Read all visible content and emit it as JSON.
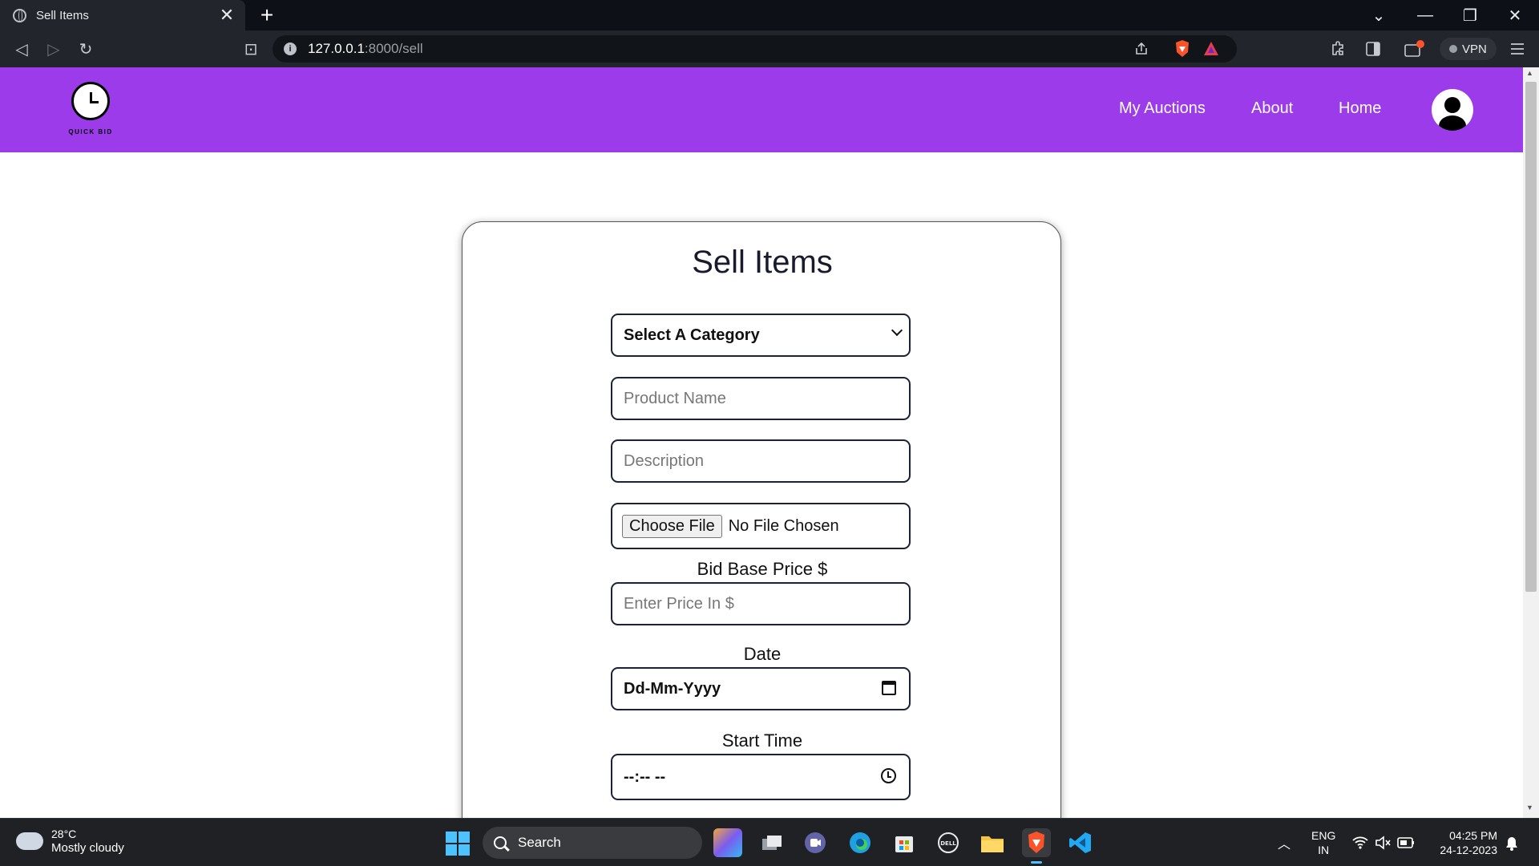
{
  "browser": {
    "tab_title": "Sell Items",
    "tab_close": "✕",
    "new_tab": "+",
    "url_host": "127.0.0.1",
    "url_path": ":8000/sell",
    "vpn_label": "VPN",
    "window_controls": {
      "dropdown": "⌄",
      "minimize": "—",
      "restore": "❐",
      "close": "✕"
    },
    "nav": {
      "back": "◁",
      "forward": "▷",
      "reload": "↻",
      "bookmark": "⊡"
    }
  },
  "navbar": {
    "logo_text": "QUICK BID",
    "links": [
      "My Auctions",
      "About",
      "Home"
    ],
    "accent_color": "#9b3bea"
  },
  "form": {
    "title": "Sell Items",
    "category_select": "Select A Category",
    "product_name_placeholder": "Product Name",
    "description_placeholder": "Description",
    "choose_file_label": "Choose File",
    "no_file_text": "No File Chosen",
    "bid_price_label": "Bid Base Price $",
    "price_placeholder": "Enter Price In $",
    "date_label": "Date",
    "date_value": "Dd-Mm-Yyyy",
    "start_time_label": "Start Time",
    "start_time_value": "--:-- --"
  },
  "taskbar": {
    "weather_temp": "28°C",
    "weather_desc": "Mostly cloudy",
    "search_label": "Search",
    "lang_top": "ENG",
    "lang_bottom": "IN",
    "time": "04:25 PM",
    "date": "24-12-2023"
  }
}
